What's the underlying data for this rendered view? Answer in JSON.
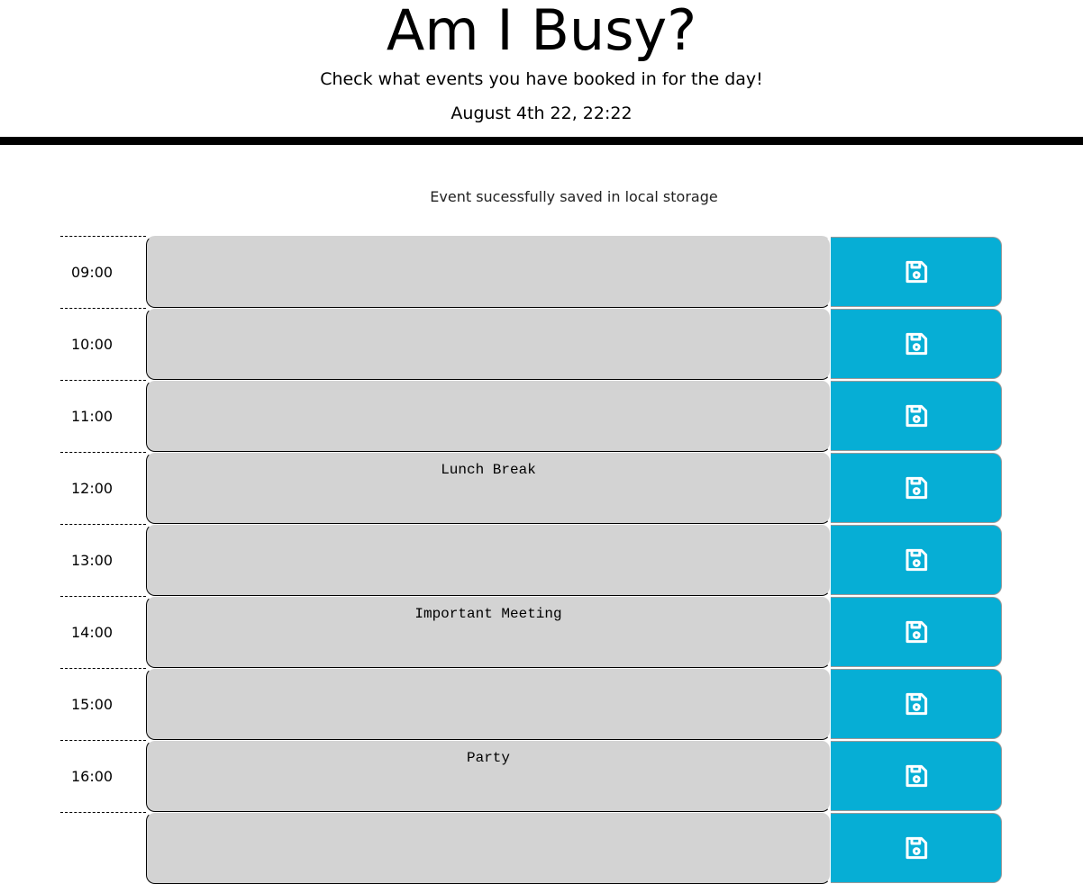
{
  "header": {
    "title": "Am I Busy?",
    "subtitle": "Check what events you have booked in for the day!",
    "current_date": "August 4th 22, 22:22"
  },
  "status_message": "Event sucessfully saved in local storage",
  "colors": {
    "save_button": "#06aed5",
    "block": "#d3d3d3"
  },
  "schedule": [
    {
      "hour": "09:00",
      "event": ""
    },
    {
      "hour": "10:00",
      "event": ""
    },
    {
      "hour": "11:00",
      "event": ""
    },
    {
      "hour": "12:00",
      "event": "Lunch Break"
    },
    {
      "hour": "13:00",
      "event": ""
    },
    {
      "hour": "14:00",
      "event": "Important Meeting"
    },
    {
      "hour": "15:00",
      "event": ""
    },
    {
      "hour": "16:00",
      "event": "Party"
    },
    {
      "hour": "",
      "event": ""
    }
  ],
  "icons": {
    "save": "floppy-disk-icon"
  }
}
